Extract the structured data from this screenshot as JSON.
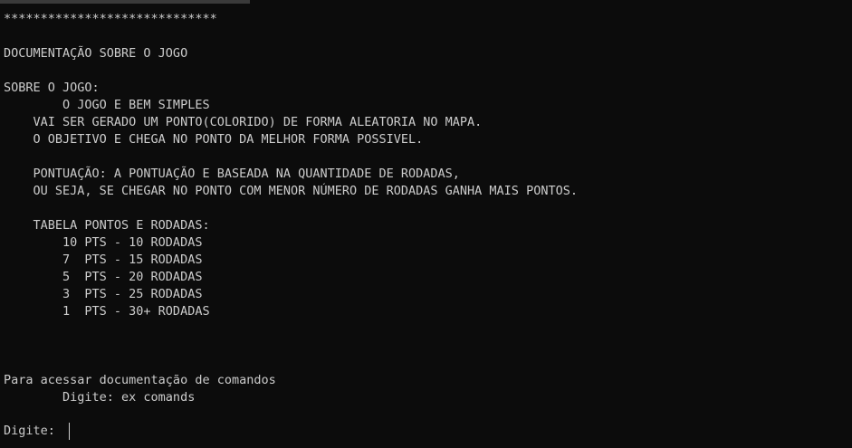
{
  "terminal": {
    "lines": [
      "*****************************",
      "DOCUMENTAÇÃO SOBRE O JOGO",
      "SOBRE O JOGO:",
      "        O JOGO E BEM SIMPLES",
      "    VAI SER GERADO UM PONTO(COLORIDO) DE FORMA ALEATORIA NO MAPA.",
      "    O OBJETIVO E CHEGA NO PONTO DA MELHOR FORMA POSSIVEL.",
      "    PONTUAÇÃO: A PONTUAÇÃO E BASEADA NA QUANTIDADE DE RODADAS,",
      "    OU SEJA, SE CHEGAR NO PONTO COM MENOR NÚMERO DE RODADAS GANHA MAIS PONTOS.",
      "    TABELA PONTOS E RODADAS:",
      "        10 PTS - 10 RODADAS",
      "        7  PTS - 15 RODADAS",
      "        5  PTS - 20 RODADAS",
      "        3  PTS - 25 RODADAS",
      "        1  PTS - 30+ RODADAS",
      "Para acessar documentação de comandos",
      "        Digite: ex comands"
    ],
    "prompt_label": "Digite: ",
    "input_value": ""
  },
  "colors": {
    "background": "#0c0c0c",
    "text": "#cccccc"
  }
}
